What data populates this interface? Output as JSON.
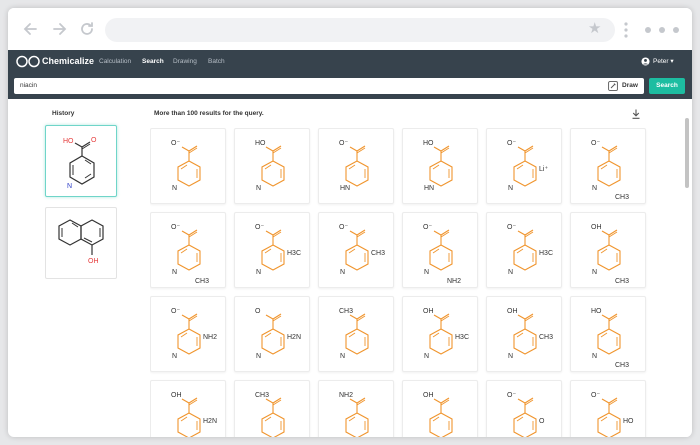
{
  "app": {
    "brand": "Chemicalize",
    "tabs": [
      {
        "label": "Calculation",
        "active": false
      },
      {
        "label": "Search",
        "active": true
      },
      {
        "label": "Drawing",
        "active": false
      },
      {
        "label": "Batch",
        "active": false
      }
    ],
    "user": "Peter"
  },
  "search": {
    "query": "niacin",
    "draw_label": "Draw",
    "button_label": "Search"
  },
  "history": {
    "title": "History"
  },
  "results": {
    "title": "More than 100 results for the query.",
    "tiles": [
      {
        "top": "O⁻",
        "side": "",
        "bottom": "",
        "ring": "N"
      },
      {
        "top": "HO",
        "side": "",
        "bottom": "",
        "ring": "N"
      },
      {
        "top": "O⁻",
        "side": "",
        "bottom": "",
        "ring": "HN"
      },
      {
        "top": "HO",
        "side": "",
        "bottom": "",
        "ring": "HN"
      },
      {
        "top": "O⁻",
        "side": "Li⁺",
        "bottom": "",
        "ring": "N"
      },
      {
        "top": "O⁻",
        "side": "",
        "bottom": "CH3",
        "ring": "N"
      },
      {
        "top": "O⁻",
        "side": "",
        "bottom": "CH3",
        "ring": "N"
      },
      {
        "top": "O⁻",
        "side": "H3C",
        "bottom": "",
        "ring": "N"
      },
      {
        "top": "O⁻",
        "side": "CH3",
        "bottom": "",
        "ring": "N"
      },
      {
        "top": "O⁻",
        "side": "",
        "bottom": "NH2",
        "ring": "N"
      },
      {
        "top": "O⁻",
        "side": "H3C",
        "bottom": "",
        "ring": "N"
      },
      {
        "top": "OH",
        "side": "",
        "bottom": "CH3",
        "ring": "N"
      },
      {
        "top": "O⁻",
        "side": "NH2",
        "bottom": "",
        "ring": "N"
      },
      {
        "top": "O",
        "side": "H2N",
        "bottom": "",
        "ring": "N"
      },
      {
        "top": "CH3",
        "side": "",
        "bottom": "",
        "ring": "N"
      },
      {
        "top": "OH",
        "side": "H3C",
        "bottom": "",
        "ring": "N"
      },
      {
        "top": "OH",
        "side": "CH3",
        "bottom": "",
        "ring": "N"
      },
      {
        "top": "HO",
        "side": "",
        "bottom": "CH3",
        "ring": "N"
      },
      {
        "top": "OH",
        "side": "H2N",
        "bottom": "",
        "ring": "N"
      },
      {
        "top": "CH3",
        "side": "",
        "bottom": "",
        "ring": "N"
      },
      {
        "top": "NH2",
        "side": "",
        "bottom": "",
        "ring": "N"
      },
      {
        "top": "OH",
        "side": "",
        "bottom": "",
        "ring": "N"
      },
      {
        "top": "O⁻",
        "side": "O",
        "bottom": "",
        "ring": "N"
      },
      {
        "top": "O⁻",
        "side": "HO",
        "bottom": "",
        "ring": "N"
      }
    ]
  },
  "history_items": [
    {
      "labels": [
        "HO",
        "O",
        "N"
      ]
    },
    {
      "labels": [
        "OH"
      ]
    }
  ],
  "colors": {
    "nav_bg": "#37434d",
    "accent": "#1dbda1",
    "molecule": "#f0952e"
  }
}
